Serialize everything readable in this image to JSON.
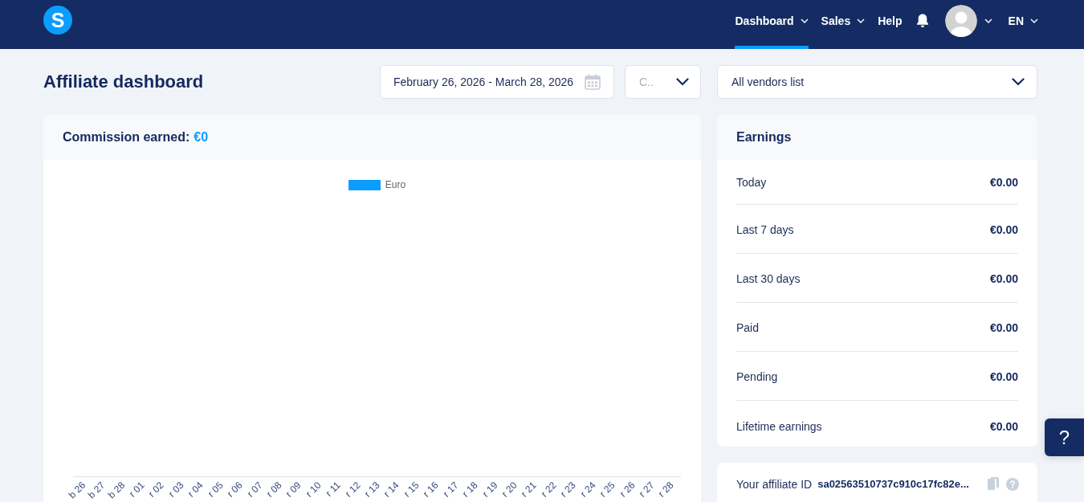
{
  "header": {
    "logo": {
      "letter": "S"
    },
    "nav": [
      {
        "label": "Dashboard",
        "selected": true,
        "dropdown": true
      },
      {
        "label": "Sales",
        "selected": false,
        "dropdown": true
      },
      {
        "label": "Help",
        "selected": false,
        "dropdown": false
      }
    ],
    "account": {
      "dropdown": true
    },
    "language": {
      "label": "EN",
      "dropdown": true
    }
  },
  "page": {
    "title": "Affiliate dashboard"
  },
  "filters": {
    "date_range": {
      "value": "February 26, 2026 - March 28, 2026"
    },
    "currency": {
      "placeholder": "C.."
    },
    "vendors": {
      "value": "All vendors list"
    }
  },
  "commission_card": {
    "label": "Commission earned:",
    "amount": "€0",
    "chart": {
      "legend": [
        {
          "label": "Euro",
          "color": "#0a9dff"
        }
      ],
      "x_labels": [
        "b 26",
        "b 27",
        "b 28",
        "r 01",
        "r 02",
        "r 03",
        "r 04",
        "r 05",
        "r 06",
        "r 07",
        "r 08",
        "r 09",
        "r 10",
        "r 11",
        "r 12",
        "r 13",
        "r 14",
        "r 15",
        "r 16",
        "r 17",
        "r 18",
        "r 19",
        "r 20",
        "r 21",
        "r 22",
        "r 23",
        "r 24",
        "r 25",
        "r 26",
        "r 27",
        "r 28"
      ]
    }
  },
  "earnings": {
    "title": "Earnings",
    "rows": [
      {
        "label": "Today",
        "value": "€0.00"
      },
      {
        "label": "Last 7 days",
        "value": "€0.00"
      },
      {
        "label": "Last 30 days",
        "value": "€0.00"
      },
      {
        "label": "Paid",
        "value": "€0.00"
      },
      {
        "label": "Pending",
        "value": "€0.00"
      },
      {
        "label": "Lifetime earnings",
        "value": "€0.00"
      }
    ]
  },
  "affiliate_id": {
    "label": "Your affiliate ID",
    "value": "sa02563510737c910c17fc82e..."
  },
  "help_button": {
    "label": "?"
  }
}
